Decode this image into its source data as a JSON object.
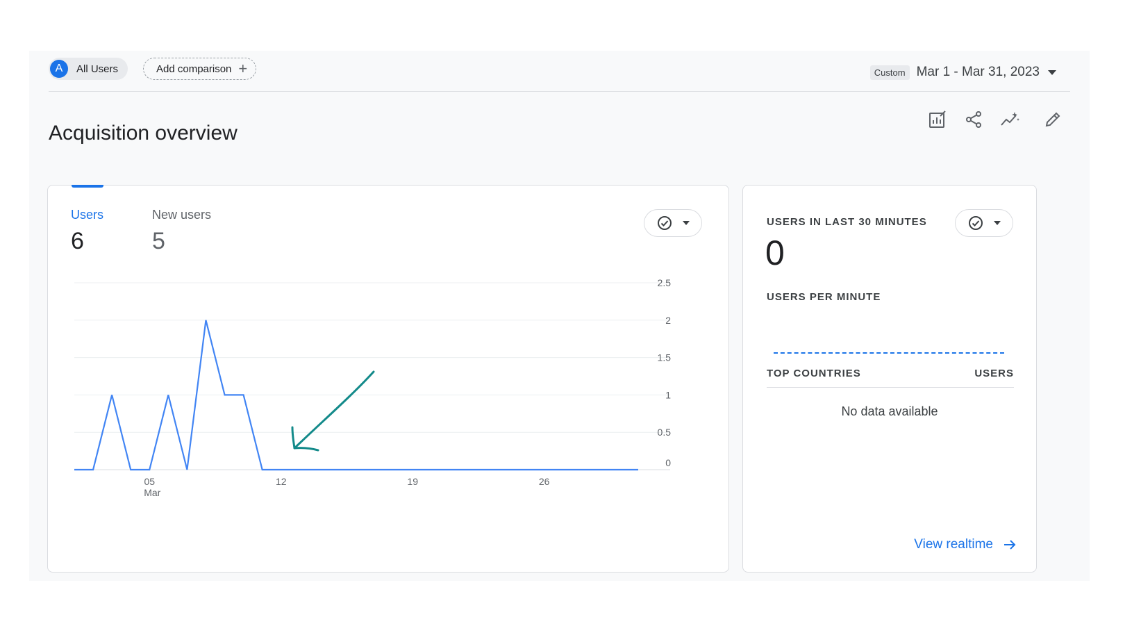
{
  "header": {
    "segment_avatar_letter": "A",
    "segment_label": "All Users",
    "add_comparison_label": "Add comparison",
    "date_badge": "Custom",
    "date_range": "Mar 1 - Mar 31, 2023"
  },
  "page": {
    "title": "Acquisition overview",
    "toolbar_icons": [
      "customize-report-icon",
      "share-icon",
      "insights-icon",
      "edit-icon"
    ]
  },
  "users_card": {
    "tabs": [
      {
        "label": "Users",
        "value": "6",
        "active": true
      },
      {
        "label": "New users",
        "value": "5",
        "active": false
      }
    ]
  },
  "chart_data": {
    "type": "line",
    "series": [
      {
        "color": "#4285f4",
        "x": [
          1,
          2,
          3,
          4,
          5,
          6,
          7,
          8,
          9,
          10,
          11,
          12,
          13,
          14,
          15,
          16,
          17,
          18,
          19,
          20,
          21,
          22,
          23,
          24,
          25,
          26,
          27,
          28,
          29,
          30,
          31
        ],
        "values": [
          0,
          0,
          1,
          0,
          0,
          1,
          0,
          2,
          1,
          1,
          0,
          0,
          0,
          0,
          0,
          0,
          0,
          0,
          0,
          0,
          0,
          0,
          0,
          0,
          0,
          0,
          0,
          0,
          0,
          0,
          0
        ]
      }
    ],
    "x_ticks": [
      {
        "day": 5,
        "label": "05",
        "sublabel": "Mar"
      },
      {
        "day": 12,
        "label": "12",
        "sublabel": ""
      },
      {
        "day": 19,
        "label": "19",
        "sublabel": ""
      },
      {
        "day": 26,
        "label": "26",
        "sublabel": ""
      }
    ],
    "y_ticks": [
      "2.5",
      "2",
      "1.5",
      "1",
      "0.5",
      "0"
    ],
    "ylim": [
      0,
      2.5
    ],
    "grid": true,
    "annotation": "teal hand-drawn arrow pointing to the line after Mar 11"
  },
  "realtime_card": {
    "title": "USERS IN LAST 30 MINUTES",
    "value": "0",
    "per_minute_label": "USERS PER MINUTE",
    "countries_label": "TOP COUNTRIES",
    "users_col_label": "USERS",
    "empty_text": "No data available",
    "link_label": "View realtime"
  },
  "colors": {
    "accent": "#1a73e8",
    "line": "#4285f4",
    "annotation": "#138a8a"
  }
}
